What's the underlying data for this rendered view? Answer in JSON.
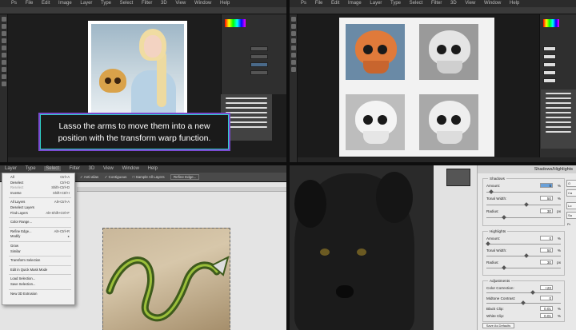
{
  "q1": {
    "menu": [
      "Ps",
      "File",
      "Edit",
      "Image",
      "Layer",
      "Type",
      "Select",
      "Filter",
      "3D",
      "View",
      "Window",
      "Help"
    ],
    "caption_line1": "Lasso the arms to move them into a new",
    "caption_line2": "position with the transform warp function."
  },
  "q2": {
    "menu": [
      "Ps",
      "File",
      "Edit",
      "Image",
      "Layer",
      "Type",
      "Select",
      "Filter",
      "3D",
      "View",
      "Window",
      "Help"
    ]
  },
  "q3": {
    "menubar": [
      "Layer",
      "Type",
      "Select",
      "Filter",
      "3D",
      "View",
      "Window",
      "Help"
    ],
    "options": {
      "anti_alias": "Anti-alias",
      "contiguous": "Contiguous",
      "sample_all": "Sample All Layers",
      "refine": "Refine Edge..."
    },
    "select_menu": [
      {
        "label": "All",
        "shortcut": "Ctrl+A"
      },
      {
        "label": "Deselect",
        "shortcut": "Ctrl+D"
      },
      {
        "label": "Reselect",
        "shortcut": "Shift+Ctrl+D",
        "dim": true
      },
      {
        "label": "Inverse",
        "shortcut": "Shift+Ctrl+I"
      },
      {
        "sep": true
      },
      {
        "label": "All Layers",
        "shortcut": "Alt+Ctrl+A"
      },
      {
        "label": "Deselect Layers",
        "shortcut": ""
      },
      {
        "label": "Find Layers",
        "shortcut": "Alt+Shift+Ctrl+F"
      },
      {
        "sep": true
      },
      {
        "label": "Color Range...",
        "shortcut": ""
      },
      {
        "sep": true
      },
      {
        "label": "Refine Edge...",
        "shortcut": "Alt+Ctrl+R"
      },
      {
        "label": "Modify",
        "shortcut": "▸"
      },
      {
        "sep": true
      },
      {
        "label": "Grow",
        "shortcut": ""
      },
      {
        "label": "Similar",
        "shortcut": ""
      },
      {
        "sep": true
      },
      {
        "label": "Transform Selection",
        "shortcut": ""
      },
      {
        "sep": true
      },
      {
        "label": "Edit in Quick Mask Mode",
        "shortcut": ""
      },
      {
        "sep": true
      },
      {
        "label": "Load Selection...",
        "shortcut": ""
      },
      {
        "label": "Save Selection...",
        "shortcut": ""
      },
      {
        "sep": true
      },
      {
        "label": "New 3D Extrusion",
        "shortcut": ""
      }
    ]
  },
  "q4": {
    "dialog_title": "Shadows/Highlights",
    "shadows": {
      "group": "Shadows",
      "amount_label": "Amount:",
      "amount": "5",
      "tonal_label": "Tonal Width:",
      "tonal": "50",
      "radius_label": "Radius:",
      "radius": "30",
      "unit_px": "px",
      "unit_pct": "%"
    },
    "highlights": {
      "group": "Highlights",
      "amount_label": "Amount:",
      "amount": "0",
      "tonal_label": "Tonal Width:",
      "tonal": "50",
      "radius_label": "Radius:",
      "radius": "30"
    },
    "adjustments": {
      "group": "Adjustments",
      "color_label": "Color Correction:",
      "color": "+20",
      "midtone_label": "Midtone Contrast:",
      "midtone": "0",
      "black_label": "Black Clip:",
      "black": "0.01",
      "white_label": "White Clip:",
      "white": "0.01"
    },
    "save_defaults": "Save As Defaults",
    "side_buttons": [
      "O",
      "Ca",
      "Lo",
      "Sa",
      "Pr"
    ]
  }
}
